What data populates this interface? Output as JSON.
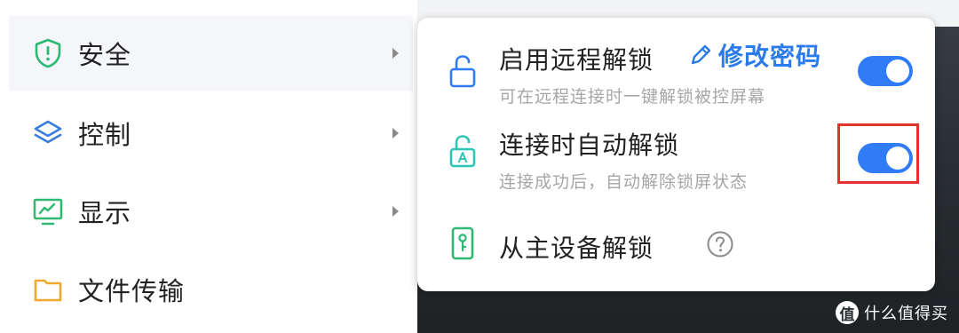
{
  "menu": {
    "items": [
      {
        "label": "安全",
        "icon": "shield-icon",
        "has_submenu": true,
        "active": true
      },
      {
        "label": "控制",
        "icon": "layers-icon",
        "has_submenu": true,
        "active": false
      },
      {
        "label": "显示",
        "icon": "monitor-icon",
        "has_submenu": true,
        "active": false
      },
      {
        "label": "文件传输",
        "icon": "folder-icon",
        "has_submenu": false,
        "active": false
      }
    ]
  },
  "security_panel": {
    "remote_unlock": {
      "title": "启用远程解锁",
      "subtitle": "可在远程连接时一键解锁被控屏幕",
      "edit_password_label": "修改密码",
      "enabled": true
    },
    "auto_unlock": {
      "title": "连接时自动解锁",
      "subtitle": "连接成功后，自动解除锁屏状态",
      "enabled": true,
      "highlighted": true
    },
    "main_device_unlock": {
      "title": "从主设备解锁",
      "help_icon": "question-icon"
    }
  },
  "watermark": {
    "badge": "值",
    "text": "什么值得买"
  },
  "colors": {
    "accent": "#2f7cf6",
    "link": "#2b7bea",
    "highlight": "#e0342b",
    "shield": "#2eb872",
    "layers": "#3b7ddd",
    "monitor": "#2eb872",
    "folder": "#f0a92e",
    "lock": "#2f7cf6",
    "auto_lock": "#2ec4b6",
    "phone": "#2eb872"
  }
}
